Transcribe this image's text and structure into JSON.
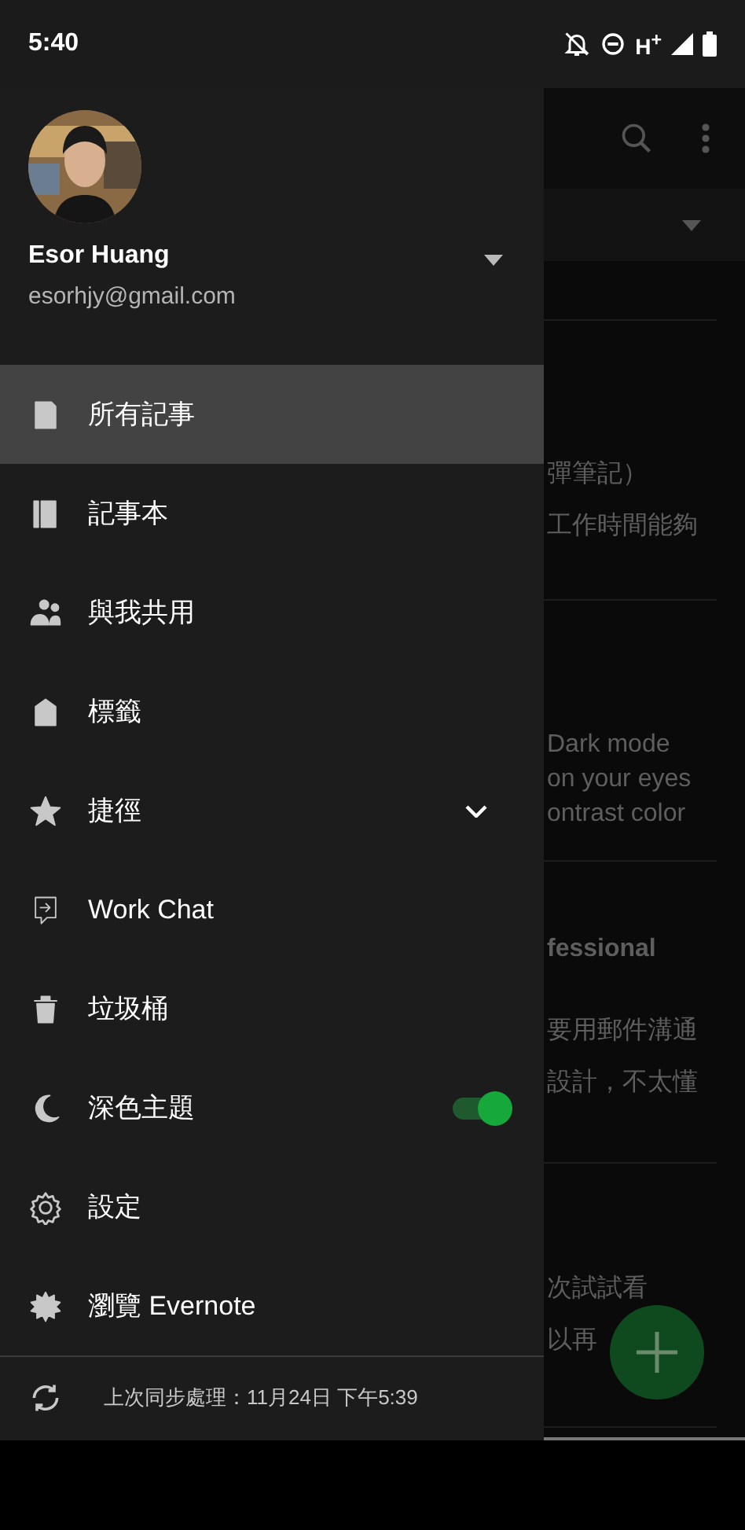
{
  "status_bar": {
    "time": "5:40",
    "network": "H$^{+}$"
  },
  "account": {
    "name": "Esor Huang",
    "email": "esorhjy@gmail.com"
  },
  "menu": [
    {
      "label": "所有記事",
      "selected": true,
      "kind": "item"
    },
    {
      "label": "記事本",
      "selected": false,
      "kind": "item"
    },
    {
      "label": "與我共用",
      "selected": false,
      "kind": "item"
    },
    {
      "label": "標籤",
      "selected": false,
      "kind": "item"
    },
    {
      "label": "捷徑",
      "selected": false,
      "kind": "expandable",
      "expanded": false
    },
    {
      "label": "Work Chat",
      "selected": false,
      "kind": "item"
    },
    {
      "label": "垃圾桶",
      "selected": false,
      "kind": "item"
    },
    {
      "label": "深色主題",
      "selected": false,
      "kind": "toggle",
      "on": true
    },
    {
      "label": "設定",
      "selected": false,
      "kind": "item"
    },
    {
      "label": "瀏覽 Evernote",
      "selected": false,
      "kind": "item"
    }
  ],
  "sync": {
    "text": "上次同步處理：11月24日 下午5:39"
  },
  "background_notes": [
    {
      "lines": [
        "彈筆記）",
        "工作時間能夠"
      ]
    },
    {
      "lines": [
        "Dark mode",
        "on your eyes",
        "ontrast color"
      ]
    },
    {
      "lines": [
        "fessional",
        "要用郵件溝通",
        "設計，不太懂"
      ]
    },
    {
      "lines": [
        "次試試看",
        "以再"
      ]
    }
  ]
}
